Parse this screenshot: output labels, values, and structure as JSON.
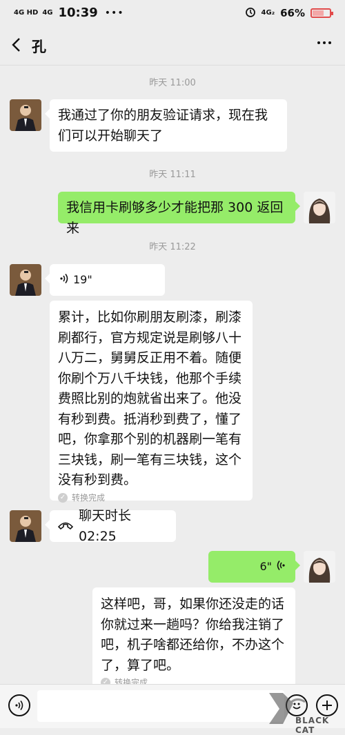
{
  "status_bar": {
    "net1": "4G HD",
    "net2": "4G",
    "time": "10:39",
    "dots": "•••",
    "net3": "4G₂",
    "battery": "66%",
    "battery_level": 0.66
  },
  "header": {
    "title": "孔"
  },
  "messages": [
    {
      "timestamp": "昨天 11:00"
    },
    {
      "text": "我通过了你的朋友验证请求，现在我们可以开始聊天了"
    },
    {
      "timestamp": "昨天 11:11"
    },
    {
      "text": "我信用卡刷够多少才能把那 300 返回来"
    },
    {
      "timestamp": "昨天 11:22"
    },
    {
      "voice": "19\""
    },
    {
      "text": "累计，比如你刷朋友刷漆，刷漆刷都行，官方规定说是刷够八十八万二，舅舅反正用不着。随便你刷个万八千块钱，他那个手续费照比别的炮就省出来了。他没有秒到费。抵消秒到费了，懂了吧，你拿那个别的机器刷一笔有三块钱，刷一笔有三块钱，这个没有秒到费。",
      "note": "转换完成"
    },
    {
      "call": "聊天时长 02:25"
    },
    {
      "voice": "6\""
    },
    {
      "text": "这样吧，哥，如果你还没走的话你就过来一趟吗？你给我注销了吧，机子啥都还给你，不办这个了，算了吧。",
      "note": "转换完成"
    }
  ],
  "watermark": "BLACK CAT"
}
